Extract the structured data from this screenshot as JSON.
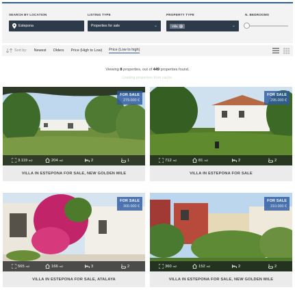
{
  "search": {
    "location_label": "SEARCH BY LOCATION",
    "location_value": "Estepona",
    "listing_label": "LISTING TYPE",
    "listing_value": "Properties for sale",
    "property_label": "PROPERTY TYPE",
    "property_tag": "Villa",
    "bedrooms_label": "N. BEDROOMS"
  },
  "sortbar": {
    "label": "Sort by:",
    "options": [
      "Newest",
      "Olders",
      "Price (High to Low)",
      "Price (Low to high)"
    ],
    "active_index": 3
  },
  "results": {
    "prefix": "Viewing",
    "shown": "8",
    "middle": "properties, out of",
    "total": "449",
    "suffix": "properties found.",
    "loading": "Loading properties from cache."
  },
  "colors": {
    "accent": "#2a5aa0",
    "field_bg": "#2d3a4a",
    "panel_bg": "#f3f3f3"
  },
  "listings": [
    {
      "badge": "FOR SALE",
      "price": "279.000 €",
      "plot": "3.119",
      "built": "204",
      "unit": "m2",
      "bedrooms": "2",
      "bathrooms": "1",
      "title": "VILLA IN ESTEPONA FOR SALE, NEW GOLDEN MILE"
    },
    {
      "badge": "FOR SALE",
      "price": "295.000 €",
      "plot": "712",
      "built": "81",
      "unit": "m2",
      "bedrooms": "2",
      "bathrooms": "2",
      "title": "VILLA IN ESTEPONA FOR SALE"
    },
    {
      "badge": "FOR SALE",
      "price": "300.000 €",
      "plot": "565",
      "built": "166",
      "unit": "m2",
      "bedrooms": "3",
      "bathrooms": "2",
      "title": "VILLA IN ESTEPONA FOR SALE, ATALAYA"
    },
    {
      "badge": "FOR SALE",
      "price": "310.000 €",
      "plot": "360",
      "built": "152",
      "unit": "m2",
      "bedrooms": "2",
      "bathrooms": "2",
      "title": "VILLA IN ESTEPONA FOR SALE, NEW GOLDEN MILE"
    }
  ]
}
